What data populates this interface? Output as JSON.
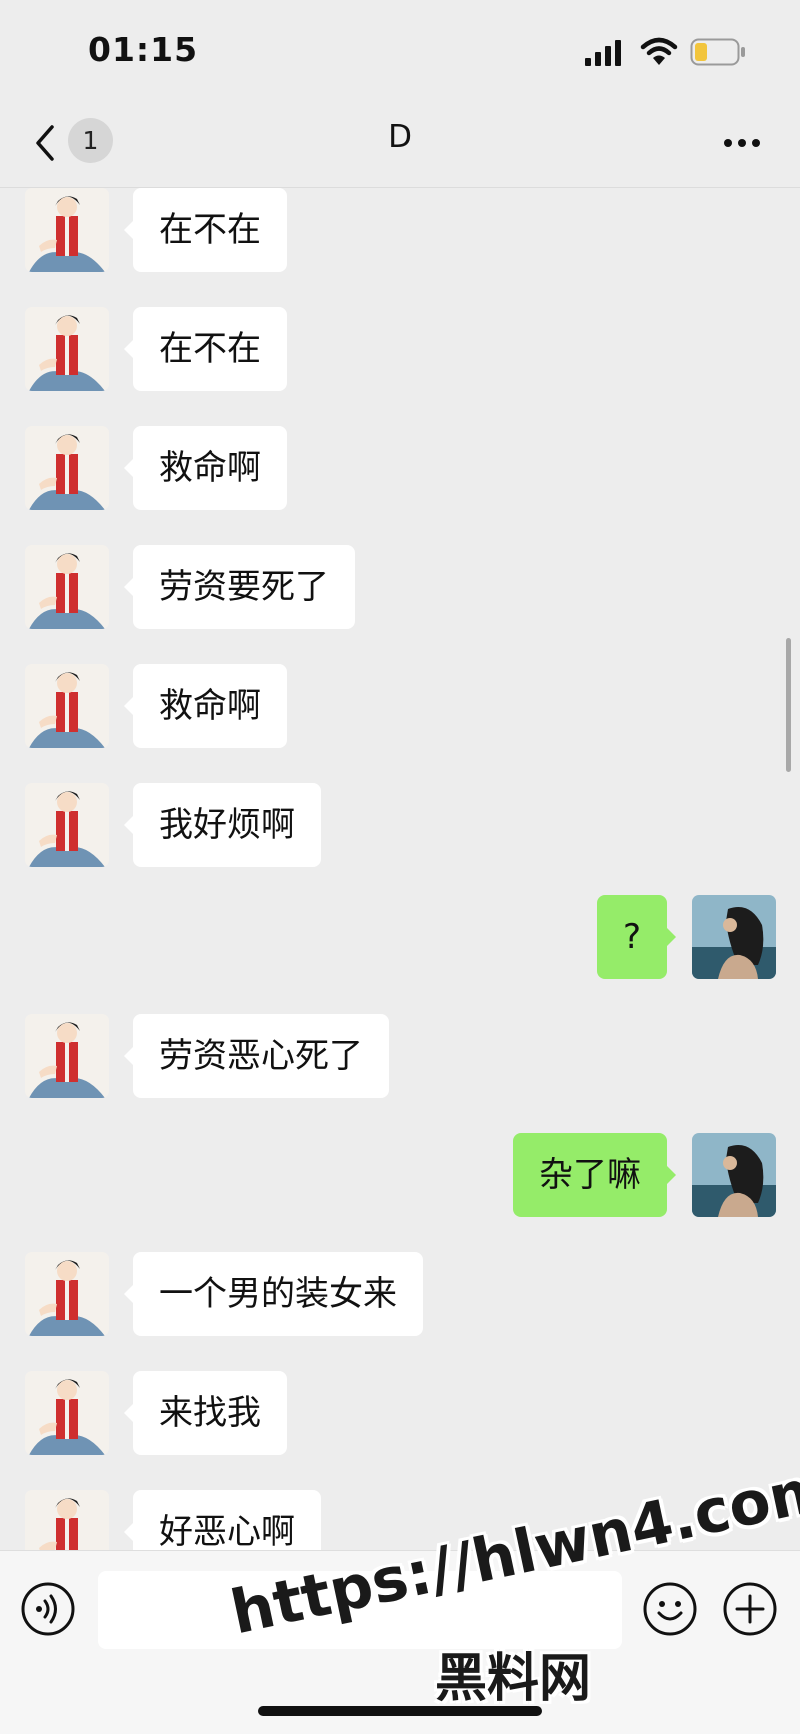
{
  "status_bar": {
    "time": "01:15",
    "icons": [
      "signal-icon",
      "wifi-icon",
      "battery-icon"
    ],
    "battery_color": "#f2c53d"
  },
  "nav": {
    "back_icon": "chevron-left-icon",
    "unread_count": "1",
    "title": "D",
    "more_icon": "more-icon"
  },
  "colors": {
    "background": "#ededed",
    "received_bubble": "#ffffff",
    "sent_bubble": "#95ec69"
  },
  "messages": [
    {
      "side": "received",
      "text": "在不在"
    },
    {
      "side": "received",
      "text": "在不在"
    },
    {
      "side": "received",
      "text": "救命啊"
    },
    {
      "side": "received",
      "text": "劳资要死了"
    },
    {
      "side": "received",
      "text": "救命啊"
    },
    {
      "side": "received",
      "text": "我好烦啊"
    },
    {
      "side": "sent",
      "text": "?"
    },
    {
      "side": "received",
      "text": "劳资恶心死了"
    },
    {
      "side": "sent",
      "text": "杂了嘛"
    },
    {
      "side": "received",
      "text": "一个男的装女来"
    },
    {
      "side": "received",
      "text": "来找我"
    },
    {
      "side": "received",
      "text": "好恶心啊"
    }
  ],
  "input_bar": {
    "icons": [
      "voice-icon",
      "emoji-icon",
      "plus-icon"
    ]
  },
  "watermark": {
    "url": "https://hlwn4.com",
    "name": "黑料网"
  }
}
